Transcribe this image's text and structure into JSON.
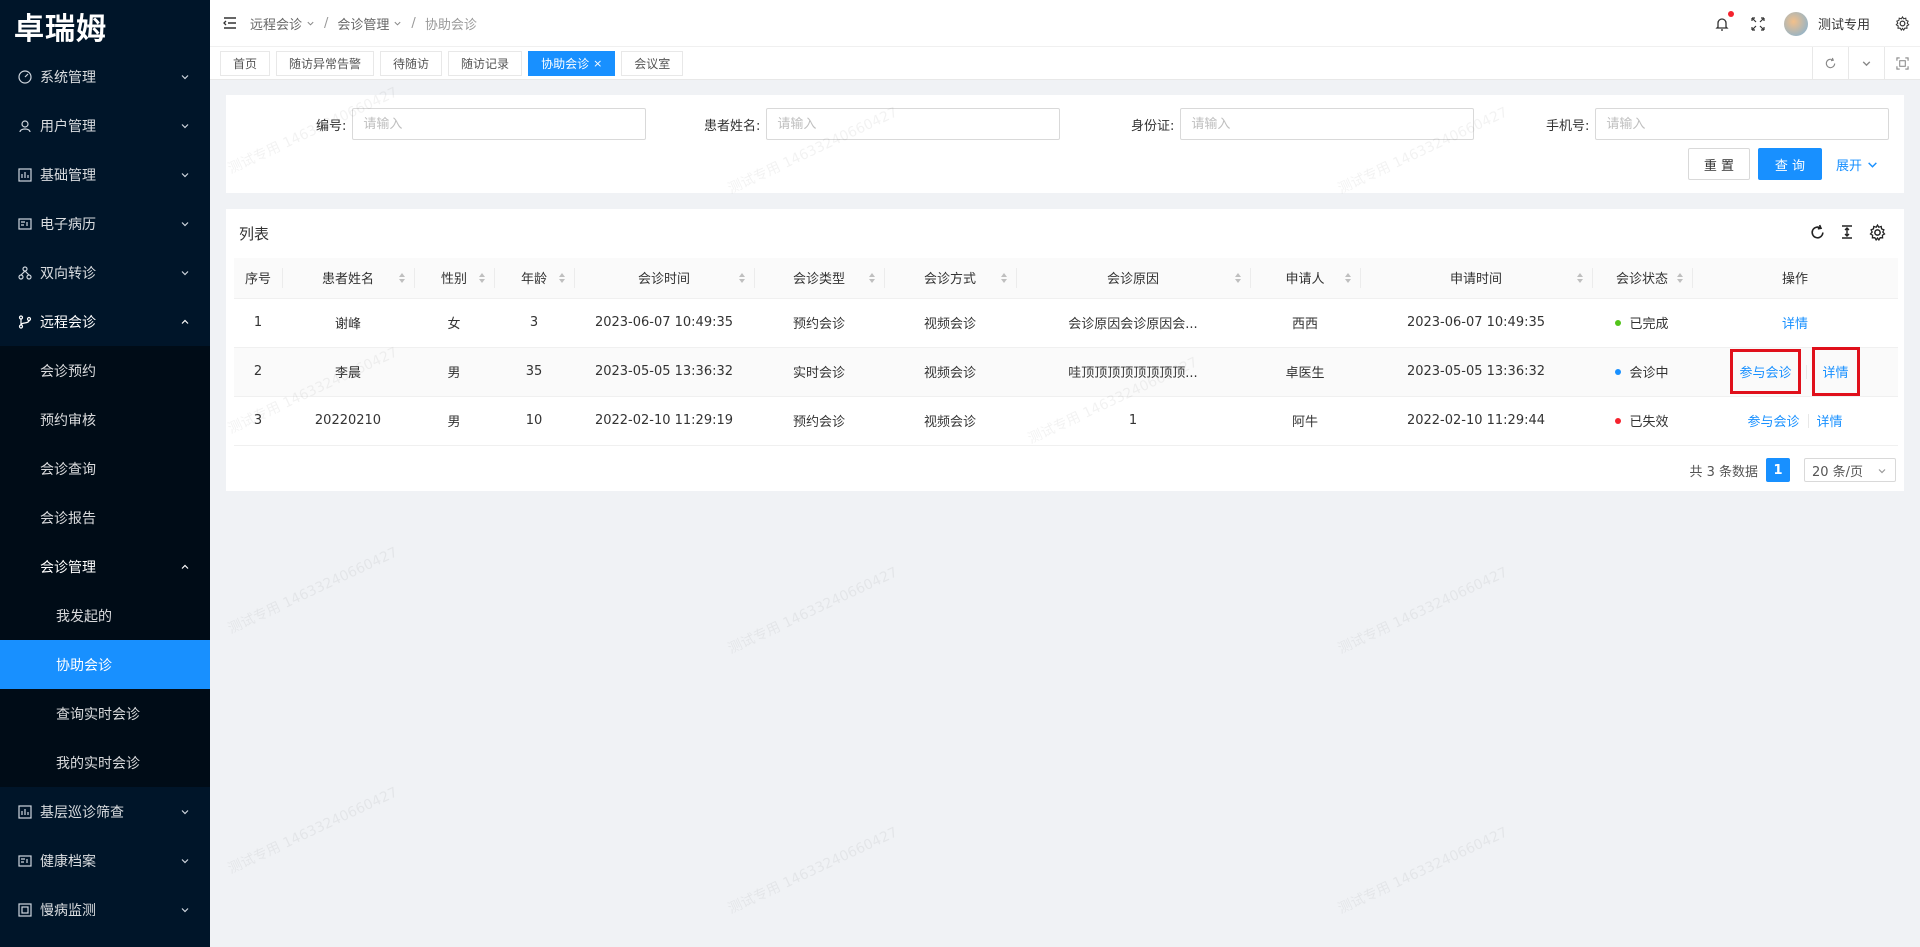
{
  "app": {
    "logo": "卓瑞姆"
  },
  "sidebar": {
    "items": [
      {
        "label": "系统管理",
        "icon": "dashboard-icon"
      },
      {
        "label": "用户管理",
        "icon": "user-icon"
      },
      {
        "label": "基础管理",
        "icon": "chart-box-icon"
      },
      {
        "label": "电子病历",
        "icon": "id-card-icon"
      },
      {
        "label": "双向转诊",
        "icon": "cluster-icon"
      },
      {
        "label": "远程会诊",
        "icon": "branch-icon"
      }
    ],
    "remote_sub": [
      {
        "label": "会诊预约"
      },
      {
        "label": "预约审核"
      },
      {
        "label": "会诊查询"
      },
      {
        "label": "会诊报告"
      },
      {
        "label": "会诊管理"
      }
    ],
    "manage_sub": [
      {
        "label": "我发起的"
      },
      {
        "label": "协助会诊"
      },
      {
        "label": "查询实时会诊"
      },
      {
        "label": "我的实时会诊"
      }
    ],
    "bottom_items": [
      {
        "label": "基层巡诊筛查",
        "icon": "chart-box-icon"
      },
      {
        "label": "健康档案",
        "icon": "id-card-icon"
      },
      {
        "label": "慢病监测",
        "icon": "monitor-icon"
      }
    ]
  },
  "header": {
    "breadcrumb": [
      "远程会诊",
      "会诊管理",
      "协助会诊"
    ],
    "username": "测试专用"
  },
  "tabs": [
    {
      "label": "首页"
    },
    {
      "label": "随访异常告警"
    },
    {
      "label": "待随访"
    },
    {
      "label": "随访记录"
    },
    {
      "label": "协助会诊",
      "close": "×"
    },
    {
      "label": "会议室"
    }
  ],
  "search": {
    "fields": [
      {
        "label": "编号:",
        "placeholder": "请输入"
      },
      {
        "label": "患者姓名:",
        "placeholder": "请输入"
      },
      {
        "label": "身份证:",
        "placeholder": "请输入"
      },
      {
        "label": "手机号:",
        "placeholder": "请输入"
      }
    ],
    "reset": "重 置",
    "query": "查 询",
    "expand": "展开"
  },
  "table": {
    "title": "列表",
    "columns": [
      "序号",
      "患者姓名",
      "性别",
      "年龄",
      "会诊时间",
      "会诊类型",
      "会诊方式",
      "会诊原因",
      "申请人",
      "申请时间",
      "会诊状态",
      "操作"
    ],
    "rows": [
      {
        "idx": "1",
        "name": "谢峰",
        "gender": "女",
        "age": "3",
        "time": "2023-06-07 10:49:35",
        "type": "预约会诊",
        "mode": "视频会诊",
        "reason": "会诊原因会诊原因会...",
        "applicant": "西西",
        "apply_time": "2023-06-07 10:49:35",
        "status": "已完成",
        "status_color": "#52c41a",
        "op_join": "",
        "op_detail": "详情"
      },
      {
        "idx": "2",
        "name": "李晨",
        "gender": "男",
        "age": "35",
        "time": "2023-05-05 13:36:32",
        "type": "实时会诊",
        "mode": "视频会诊",
        "reason": "哇顶顶顶顶顶顶顶顶...",
        "applicant": "卓医生",
        "apply_time": "2023-05-05 13:36:32",
        "status": "会诊中",
        "status_color": "#1890ff",
        "op_join": "参与会诊",
        "op_detail": "详情"
      },
      {
        "idx": "3",
        "name": "20220210",
        "gender": "男",
        "age": "10",
        "time": "2022-02-10 11:29:19",
        "type": "预约会诊",
        "mode": "视频会诊",
        "reason": "1",
        "applicant": "阿牛",
        "apply_time": "2022-02-10 11:29:44",
        "status": "已失效",
        "status_color": "#f5222d",
        "op_join": "参与会诊",
        "op_detail": "详情"
      }
    ]
  },
  "pagination": {
    "total": "共 3 条数据",
    "page": "1",
    "size": "20 条/页"
  },
  "watermark": "测试专用 14633240660427",
  "colors": {
    "primary": "#1890ff",
    "sidebar_bg": "#001529",
    "highlight": "#e0101b"
  }
}
